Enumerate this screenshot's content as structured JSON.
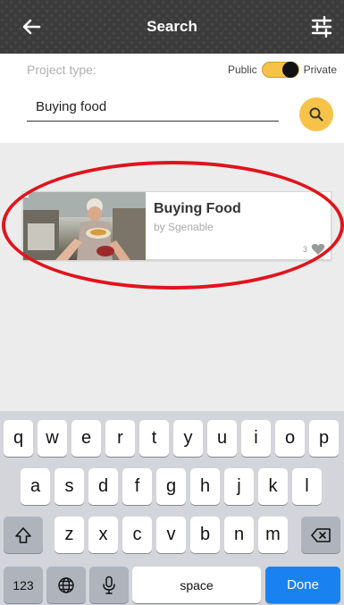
{
  "header": {
    "title": "Search",
    "back_icon": "arrow-left-icon",
    "filter_icon": "sliders-icon"
  },
  "panel": {
    "project_type_label": "Project type:",
    "toggle_public_label": "Public",
    "toggle_private_label": "Private",
    "toggle_state": "private",
    "search_value": "Buying food",
    "search_icon": "search-icon",
    "accent": "#f7c24a"
  },
  "result": {
    "title": "Buying Food",
    "author": "by Sgenable",
    "likes": "3"
  },
  "highlight_color": "#e0141c",
  "keyboard": {
    "row1": [
      "q",
      "w",
      "e",
      "r",
      "t",
      "y",
      "u",
      "i",
      "o",
      "p"
    ],
    "row2": [
      "a",
      "s",
      "d",
      "f",
      "g",
      "h",
      "j",
      "k",
      "l"
    ],
    "row3": [
      "z",
      "x",
      "c",
      "v",
      "b",
      "n",
      "m"
    ],
    "numbers_label": "123",
    "space_label": "space",
    "done_label": "Done",
    "done_color": "#1a82f0"
  }
}
